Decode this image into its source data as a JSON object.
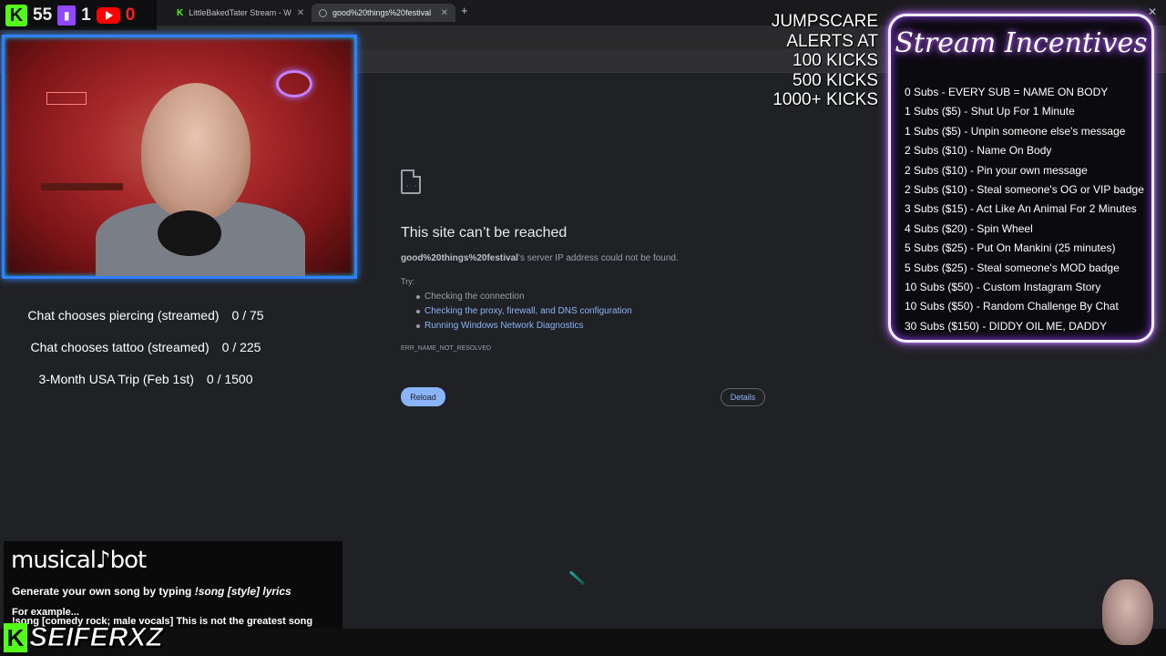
{
  "counters": {
    "kick_count": "55",
    "twitch_count": "1",
    "youtube_count": "0"
  },
  "tabs": [
    {
      "label": "LittleBakedTater Stream - W"
    },
    {
      "label": "good%20things%20festival"
    }
  ],
  "error_page": {
    "title": "This site can’t be reached",
    "host": "good%20things%20festival",
    "message": "’s server IP address could not be found.",
    "try_label": "Try:",
    "suggestions": [
      "Checking the connection",
      "Checking the proxy, firewall, and DNS configuration",
      "Running Windows Network Diagnostics"
    ],
    "error_code": "ERR_NAME_NOT_RESOLVED",
    "reload_label": "Reload",
    "details_label": "Details"
  },
  "goals": [
    {
      "label": "Chat chooses piercing (streamed)",
      "progress": "0 / 75"
    },
    {
      "label": "Chat chooses tattoo (streamed)",
      "progress": "0 / 225"
    },
    {
      "label": "3-Month USA Trip (Feb 1st)",
      "progress": "0 / 1500"
    }
  ],
  "jumpscare": {
    "lines": [
      "JUMPSCARE",
      "ALERTS AT",
      "100 KICKS",
      "500 KICKS",
      "1000+ KICKS"
    ]
  },
  "incentives": {
    "title": "Stream Incentives",
    "items": [
      "0 Subs - EVERY SUB = NAME ON BODY",
      "1 Subs ($5) - Shut Up For 1 Minute",
      "1 Subs ($5) - Unpin someone else's message",
      "2 Subs ($10) - Name On Body",
      "2 Subs ($10) - Pin your own message",
      "2 Subs ($10) - Steal someone's OG or VIP badge",
      "3 Subs ($15) - Act Like An Animal For 2 Minutes",
      "4 Subs ($20) - Spin Wheel",
      "5 Subs ($25) - Put On Mankini (25 minutes)",
      "5 Subs ($25) - Steal someone's MOD badge",
      "10 Subs ($50) - Custom Instagram Story",
      "10 Subs ($50) - Random Challenge By Chat",
      "30 Subs ($150) - DIDDY OIL ME, DADDY"
    ]
  },
  "musicalbot": {
    "logo": "musical♪bot",
    "line1_prefix": "Generate your own song by typing ",
    "line1_command": "!song [style] lyrics",
    "line2": "For example...",
    "line3": "!song [comedy rock; male vocals] This is not the greatest song"
  },
  "streamer": {
    "name": "SEIFERXZ"
  },
  "colors": {
    "kick_green": "#53fc18",
    "twitch_purple": "#9146ff",
    "youtube_red": "#ff0000",
    "link_blue": "#8ab4f8",
    "incentive_glow": "#b060ff"
  }
}
